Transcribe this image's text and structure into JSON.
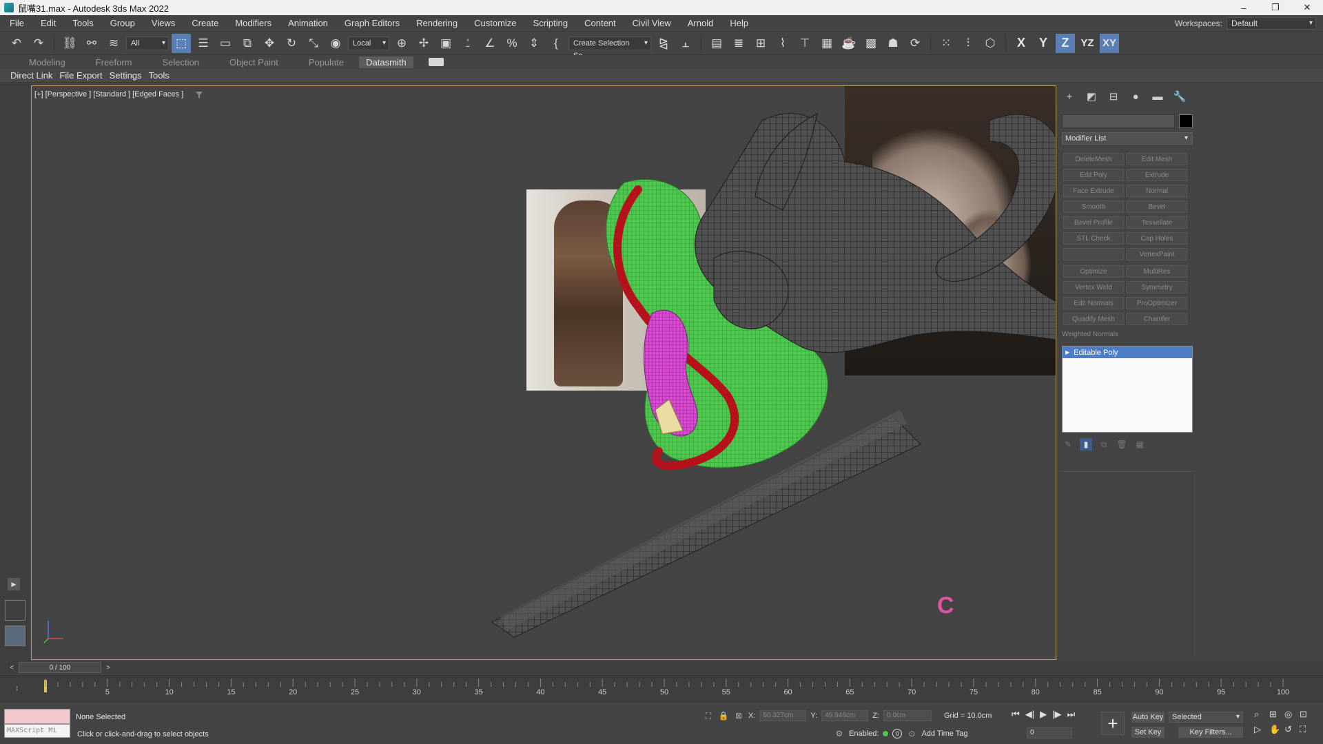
{
  "window": {
    "title": "鼠嘴31.max - Autodesk 3ds Max 2022",
    "controls": [
      "–",
      "❐",
      "✕"
    ]
  },
  "menu": {
    "items": [
      "File",
      "Edit",
      "Tools",
      "Group",
      "Views",
      "Create",
      "Modifiers",
      "Animation",
      "Graph Editors",
      "Rendering",
      "Customize",
      "Scripting",
      "Content",
      "Civil View",
      "Arnold",
      "Help"
    ],
    "workspaces_label": "Workspaces:",
    "workspaces_value": "Default"
  },
  "toolbar": {
    "filter_value": "All",
    "coord_system": "Local",
    "selection_set": "Create Selection Se",
    "axis_labels": [
      "X",
      "Y",
      "Z",
      "YZ",
      "XY"
    ]
  },
  "ribbon": {
    "tabs": [
      "Modeling",
      "Freeform",
      "Selection",
      "Object Paint",
      "Populate",
      "Datasmith"
    ],
    "active_tab": "Datasmith"
  },
  "datasmith_bar": {
    "items": [
      "Direct Link",
      "File Export",
      "Settings",
      "Tools"
    ]
  },
  "viewport": {
    "label": "[+] [Perspective ] [Standard ] [Edged Faces ]",
    "border_color": "#bfa25e",
    "cursor_glyph": "C"
  },
  "command_panel": {
    "modifier_list_label": "Modifier List",
    "modifier_buttons": [
      "DeleteMesh",
      "Edit Mesh",
      "Edit Poly",
      "Extrude",
      "Face Extrude",
      "Normal",
      "Smooth",
      "Bevel",
      "Bevel Profile",
      "Tessellate",
      "STL Check",
      "Cap Holes",
      "",
      "VertexPaint",
      "Optimize",
      "MultiRes",
      "Vertex Weld",
      "Symmetry",
      "Edit Normals",
      "ProOptimizer",
      "Quadify Mesh",
      "Chamfer"
    ],
    "weighted_normals": "Weighted Normals",
    "stack_item": "Editable Poly",
    "selection_color": "#4d7cc7"
  },
  "time_slider": {
    "label": "0 / 100"
  },
  "track_bar": {
    "tick_labels": [
      "5",
      "10",
      "15",
      "20",
      "25",
      "30",
      "35",
      "40",
      "45",
      "50",
      "55",
      "60",
      "65",
      "70",
      "75",
      "80",
      "85",
      "90",
      "95",
      "100"
    ]
  },
  "status_bar": {
    "maxscript_label": "MAXScript Mi",
    "selection_status": "None Selected",
    "prompt": "Click or click-and-drag to select objects",
    "x_label": "X:",
    "x_value": "50.327cm",
    "y_label": "Y:",
    "y_value": "49.946cm",
    "z_label": "Z:",
    "z_value": "0.0cm",
    "grid": "Grid = 10.0cm",
    "enabled_label": "Enabled:",
    "enabled_value": "0",
    "add_time_tag": "Add Time Tag",
    "frame_value": "0",
    "auto_key": "Auto Key",
    "set_key": "Set Key",
    "selected_dropdown": "Selected",
    "key_filters": "Key Filters..."
  }
}
